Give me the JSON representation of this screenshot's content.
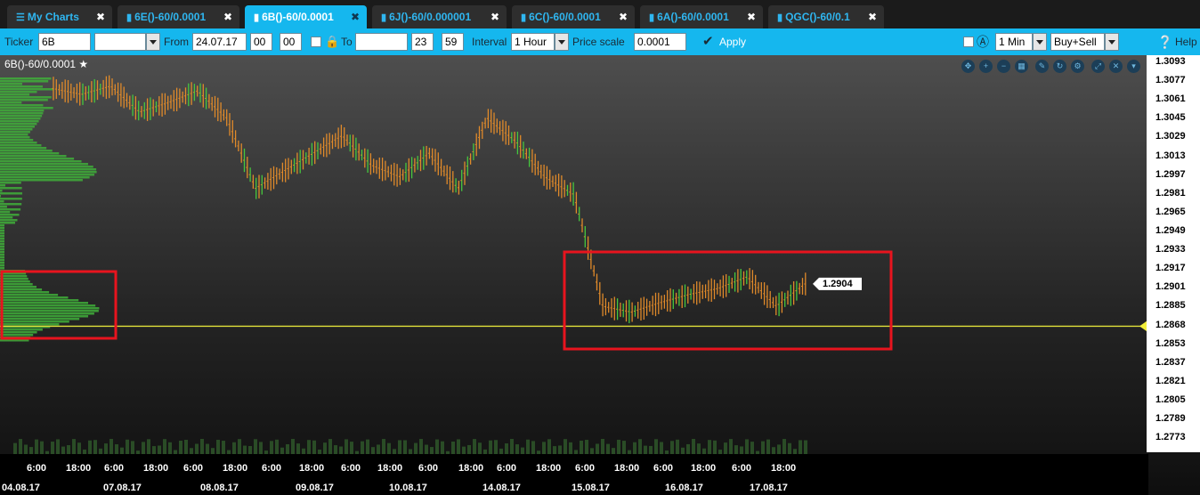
{
  "tabs": [
    {
      "label": "My Charts",
      "icon": "menu-icon"
    },
    {
      "label": "6E()-60/0.0001",
      "icon": "bar-chart-icon"
    },
    {
      "label": "6B()-60/0.0001",
      "icon": "bar-chart-icon",
      "active": true
    },
    {
      "label": "6J()-60/0.000001",
      "icon": "bar-chart-icon"
    },
    {
      "label": "6C()-60/0.0001",
      "icon": "bar-chart-icon"
    },
    {
      "label": "6A()-60/0.0001",
      "icon": "bar-chart-icon"
    },
    {
      "label": "QGC()-60/0.1",
      "icon": "bar-chart-icon"
    }
  ],
  "toolbar": {
    "ticker_label": "Ticker",
    "ticker_value": "6B",
    "ticker_select_value": "",
    "from_label": "From",
    "from_date": "24.07.17",
    "from_hour": "00",
    "from_minute": "00",
    "to_label": "To",
    "to_date": "",
    "to_hour": "23",
    "to_minute": "59",
    "interval_label": "Interval",
    "interval_value": "1 Hour",
    "price_scale_label": "Price scale",
    "price_scale_value": "0.0001",
    "apply_label": "Apply",
    "timeframe_value": "1 Min",
    "side_value": "Buy+Sell",
    "help_label": "Help"
  },
  "chart": {
    "title": "6B()-60/0.0001",
    "current_price": "1.2904",
    "highlight_price": "1.2868",
    "price_labels": [
      "1.3093",
      "1.3077",
      "1.3061",
      "1.3045",
      "1.3029",
      "1.3013",
      "1.2997",
      "1.2981",
      "1.2965",
      "1.2949",
      "1.2933",
      "1.2917",
      "1.2901",
      "1.2885",
      "1.2868",
      "1.2853",
      "1.2837",
      "1.2821",
      "1.2805",
      "1.2789",
      "1.2773"
    ],
    "time_labels": [
      "6:00",
      "18:00",
      "6:00",
      "18:00",
      "6:00",
      "18:00",
      "6:00",
      "18:00",
      "6:00",
      "18:00",
      "6:00",
      "18:00",
      "6:00",
      "18:00",
      "6:00",
      "18:00",
      "6:00",
      "18:00",
      "6:00",
      "18:00"
    ],
    "date_labels": [
      "04.08.17",
      "07.08.17",
      "08.08.17",
      "09.08.17",
      "10.08.17",
      "14.08.17",
      "15.08.17",
      "16.08.17",
      "17.08.17"
    ],
    "chart_icons": [
      "move-icon",
      "zoom-in-icon",
      "zoom-out-icon",
      "grid-icon",
      "draw-icon",
      "refresh-icon",
      "settings-icon",
      "expand-icon",
      "close-icon",
      "dropdown-icon"
    ],
    "colors": {
      "bar": "#e08a2a",
      "profile": "#3fae3a",
      "annotation": "#e8141e",
      "price_line": "#e0e03a"
    }
  },
  "chart_data": {
    "type": "ohlc",
    "x": [
      "04.08 06:00",
      "04.08 12:00",
      "04.08 18:00",
      "07.08 06:00",
      "07.08 12:00",
      "07.08 18:00",
      "08.08 06:00",
      "08.08 12:00",
      "08.08 18:00",
      "09.08 06:00",
      "09.08 12:00",
      "09.08 18:00",
      "10.08 06:00",
      "10.08 12:00",
      "10.08 18:00",
      "14.08 06:00",
      "14.08 12:00",
      "14.08 18:00",
      "15.08 06:00",
      "15.08 12:00",
      "15.08 18:00",
      "16.08 06:00",
      "16.08 12:00",
      "16.08 18:00",
      "17.08 06:00",
      "17.08 12:00",
      "17.08 18:00"
    ],
    "close": [
      1.307,
      1.3065,
      1.3072,
      1.305,
      1.3058,
      1.3068,
      1.3045,
      1.2985,
      1.3,
      1.3015,
      1.303,
      1.3005,
      1.2995,
      1.3015,
      1.2985,
      1.3045,
      1.3025,
      1.2995,
      1.298,
      1.2885,
      1.288,
      1.2888,
      1.2895,
      1.29,
      1.291,
      1.2885,
      1.2904
    ],
    "ylim": [
      1.2765,
      1.31
    ],
    "current_price": 1.2904,
    "horizontal_line": 1.2868
  }
}
